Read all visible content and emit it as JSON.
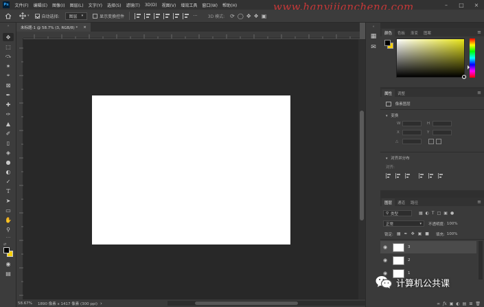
{
  "app": {
    "logo_text": "Ps"
  },
  "menu": [
    "文件(F)",
    "编辑(E)",
    "图像(I)",
    "图层(L)",
    "文字(Y)",
    "选择(S)",
    "滤镜(T)",
    "3D(D)",
    "视图(V)",
    "增效工具",
    "窗口(W)",
    "帮助(H)"
  ],
  "watermark": "www.hanyijiancheng.com",
  "options_bar": {
    "auto_select_label": "自动选择:",
    "auto_select_value": "图层",
    "show_transform_label": "显示变换控件"
  },
  "document_tab": {
    "title": "未标题-1 @ 58.7% (3, RGB/8) *",
    "close": "×"
  },
  "status_bar": {
    "zoom": "58.67%",
    "info": "1890 像素 x 1417 像素 (300 ppi)",
    "arrow": "›"
  },
  "panels": {
    "color": {
      "tabs": [
        "颜色",
        "色板",
        "渐变",
        "图案"
      ]
    },
    "properties": {
      "tabs": [
        "属性",
        "调整"
      ],
      "type_label": "像素图层",
      "transform_label": "变换",
      "fields": {
        "w": "W",
        "h": "H",
        "x": "X",
        "y": "Y",
        "angle": "△"
      },
      "align_label": "对齐并分布",
      "align_sub": "对齐:"
    },
    "layers": {
      "tabs": [
        "图层",
        "通道",
        "路径"
      ],
      "filter_label": "类型",
      "blend_mode": "正常",
      "opacity_label": "不透明度:",
      "opacity_value": "100%",
      "lock_label": "锁定:",
      "fill_label": "填充:",
      "fill_value": "100%",
      "items": [
        {
          "name": "3"
        },
        {
          "name": "2"
        },
        {
          "name": "1"
        }
      ]
    }
  },
  "wechat_badge": {
    "text": "计算机公共课"
  },
  "colors": {
    "foreground": "#000000",
    "background": "#f5cf0a",
    "watermark": "#e23a3a"
  }
}
